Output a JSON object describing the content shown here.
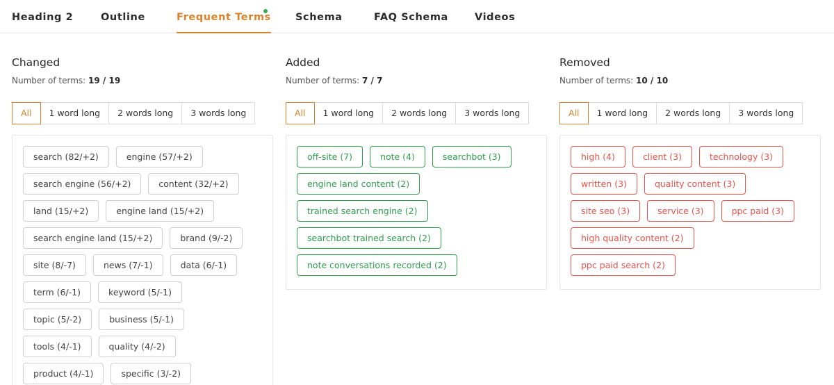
{
  "tabs": [
    {
      "label": "Heading 2",
      "active": false
    },
    {
      "label": "Outline",
      "active": false
    },
    {
      "label": "Frequent Terms",
      "active": true
    },
    {
      "label": "Schema",
      "active": false
    },
    {
      "label": "FAQ Schema",
      "active": false
    },
    {
      "label": "Videos",
      "active": false
    }
  ],
  "colors": {
    "accent": "#d9822b",
    "added": "#2f9e4f",
    "removed": "#e5534b",
    "dot": "#3aa650"
  },
  "count_prefix": "Number of terms:",
  "filters": [
    "All",
    "1 word long",
    "2 words long",
    "3 words long"
  ],
  "columns": [
    {
      "title": "Changed",
      "count": "19 / 19",
      "variant": "neutral",
      "terms": [
        "search (82/+2)",
        "engine (57/+2)",
        "search engine (56/+2)",
        "content (32/+2)",
        "land (15/+2)",
        "engine land (15/+2)",
        "search engine land (15/+2)",
        "brand (9/-2)",
        "site (8/-7)",
        "news (7/-1)",
        "data (6/-1)",
        "term (6/-1)",
        "keyword (5/-1)",
        "topic (5/-2)",
        "business (5/-1)",
        "tools (4/-1)",
        "quality (4/-2)",
        "product (4/-1)",
        "specific (3/-2)"
      ]
    },
    {
      "title": "Added",
      "count": "7 / 7",
      "variant": "green",
      "terms": [
        "off-site (7)",
        "note (4)",
        "searchbot (3)",
        "engine land content (2)",
        "trained search engine (2)",
        "searchbot trained search (2)",
        "note conversations recorded (2)"
      ]
    },
    {
      "title": "Removed",
      "count": "10 / 10",
      "variant": "red",
      "terms": [
        "high (4)",
        "client (3)",
        "technology (3)",
        "written (3)",
        "quality content (3)",
        "site seo (3)",
        "service (3)",
        "ppc paid (3)",
        "high quality content (2)",
        "ppc paid search (2)"
      ]
    }
  ]
}
